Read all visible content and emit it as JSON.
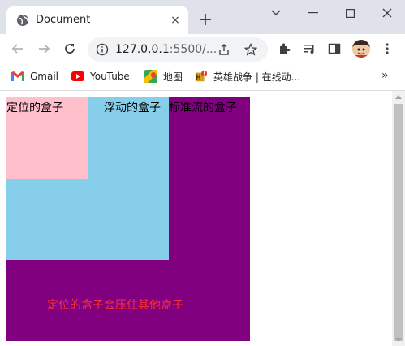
{
  "browser": {
    "tab": {
      "title": "Document",
      "favicon": "globe-icon",
      "close": "×"
    },
    "new_tab": "+",
    "window_controls": [
      "minimize-icon",
      "maximize-icon",
      "close-icon"
    ],
    "url_host": "127.0.0.1",
    "url_rest": ":5500/...",
    "bookmarks": [
      {
        "label": "Gmail",
        "icon": "gmail-icon"
      },
      {
        "label": "YouTube",
        "icon": "youtube-icon"
      },
      {
        "label": "地图",
        "icon": "maps-icon"
      },
      {
        "label": "英雄战争 | 在线动...",
        "icon": "game-icon"
      }
    ],
    "bookmarks_more": "»",
    "colors": {
      "tabstrip": "#dfe3e9",
      "omnibox": "#f1f3f4"
    }
  },
  "page": {
    "positioned_label": "定位的盒子",
    "floated_label": "浮动的盒子",
    "normal_label": "标准流的盒子",
    "caption": "定位的盒子会压住其他盒子",
    "colors": {
      "positioned": "#ffc0cb",
      "floated": "#87ceeb",
      "normal": "#800080",
      "caption": "#ff3030"
    }
  }
}
